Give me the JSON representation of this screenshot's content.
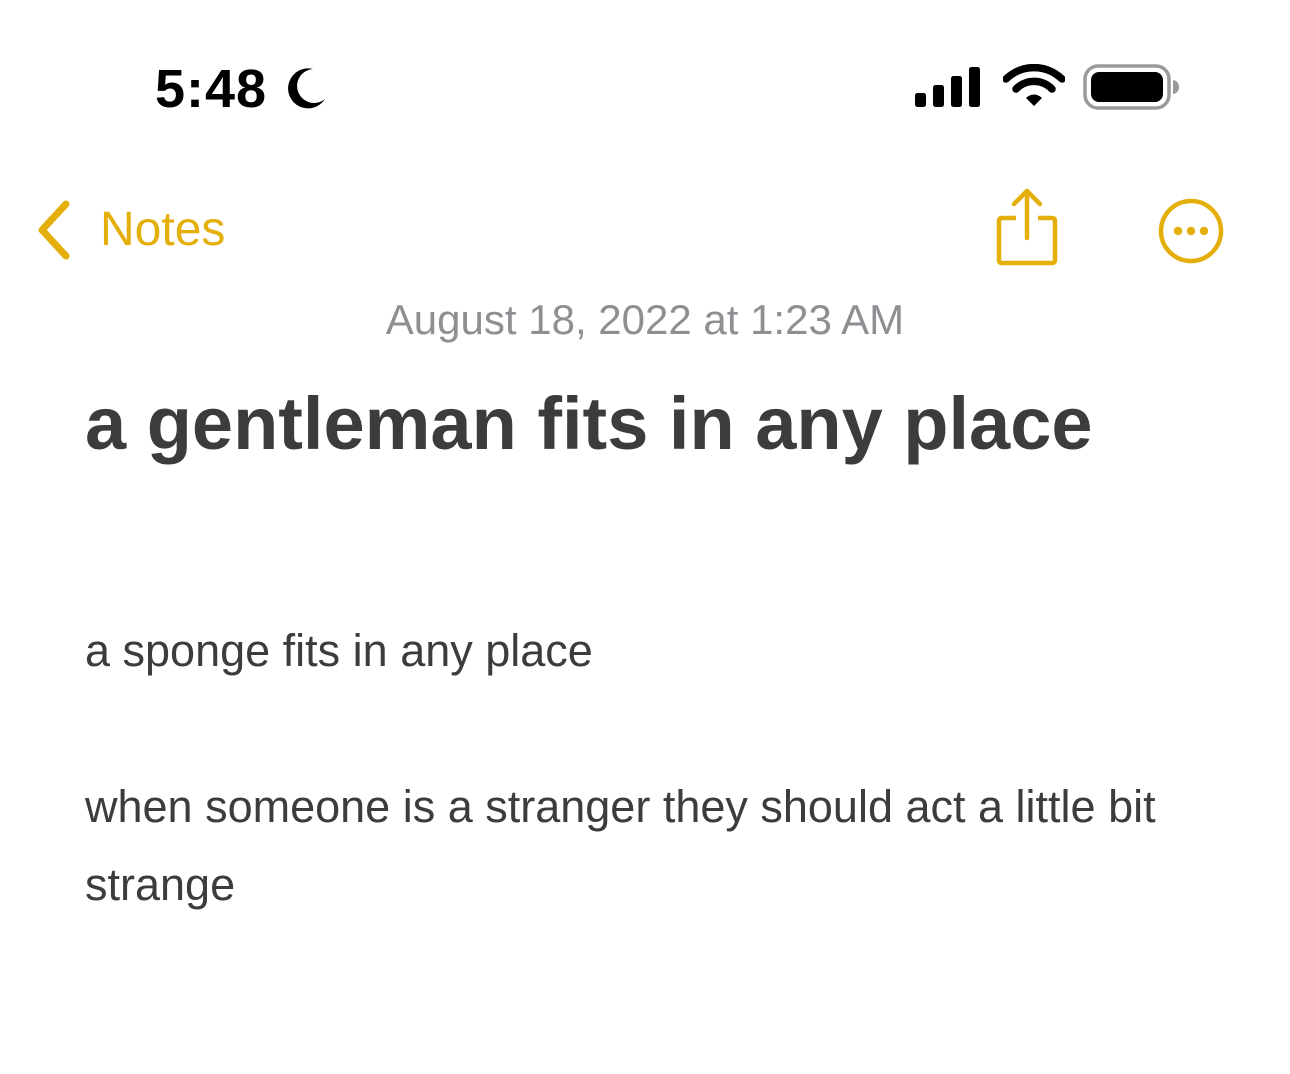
{
  "status_bar": {
    "time": "5:48",
    "focus_icon": "moon-icon",
    "signal_icon": "cellular-signal-icon",
    "wifi_icon": "wifi-icon",
    "battery_icon": "battery-icon"
  },
  "nav": {
    "back_label": "Notes",
    "back_icon": "chevron-left-icon",
    "share_icon": "share-icon",
    "more_icon": "ellipsis-circle-icon"
  },
  "note": {
    "date": "August 18, 2022 at 1:23 AM",
    "title": "a gentleman fits in any place",
    "paragraphs": [
      "a sponge fits in any place",
      "when someone is a stranger they should act a little bit strange"
    ]
  },
  "colors": {
    "accent": "#E4AF0A",
    "text": "#3c3c3e",
    "secondary_text": "#8e8e93",
    "background": "#ffffff"
  }
}
